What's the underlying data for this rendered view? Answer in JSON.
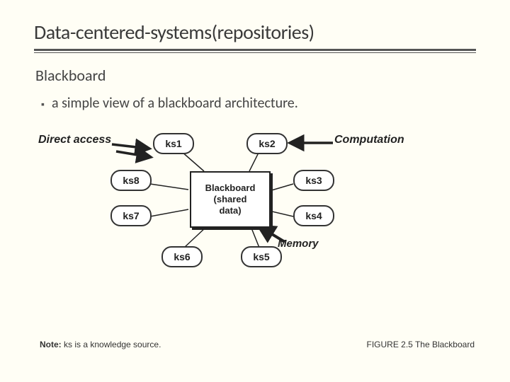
{
  "title": "Data-centered-systems(repositories)",
  "subhead": "Blackboard",
  "bullet": "a simple view of a blackboard architecture.",
  "annotations": {
    "direct_access": "Direct access",
    "computation": "Computation",
    "memory": "Memory"
  },
  "blackboard": {
    "line1": "Blackboard",
    "line2": "(shared",
    "line3": "data)"
  },
  "ks": {
    "ks1": "ks1",
    "ks2": "ks2",
    "ks3": "ks3",
    "ks4": "ks4",
    "ks5": "ks5",
    "ks6": "ks6",
    "ks7": "ks7",
    "ks8": "ks8"
  },
  "note_label": "Note:",
  "note_text": " ks is a knowledge source.",
  "figure_caption": "FIGURE 2.5  The Blackboard"
}
